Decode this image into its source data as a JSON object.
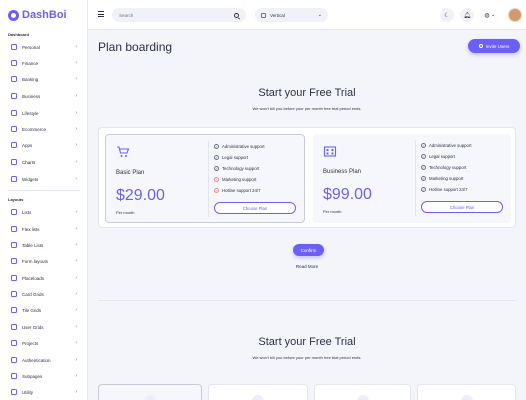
{
  "brand": {
    "name": "DashBoi"
  },
  "sidebar": {
    "sections": [
      {
        "title": "Dashboard",
        "items": [
          {
            "label": "Personal",
            "icon": "home-icon"
          },
          {
            "label": "Finance",
            "icon": "finance-icon"
          },
          {
            "label": "Banking",
            "icon": "bank-icon"
          },
          {
            "label": "Business",
            "icon": "briefcase-icon"
          },
          {
            "label": "Lifestyle",
            "icon": "heart-icon"
          },
          {
            "label": "Ecommerce",
            "icon": "cart-icon"
          },
          {
            "label": "Apps",
            "icon": "apps-icon"
          },
          {
            "label": "Charts",
            "icon": "chart-icon"
          },
          {
            "label": "Widgets",
            "icon": "widgets-icon"
          }
        ]
      },
      {
        "title": "Layouts",
        "items": [
          {
            "label": "Lists",
            "icon": "list-icon"
          },
          {
            "label": "Flex lists",
            "icon": "flex-list-icon"
          },
          {
            "label": "Table Lists",
            "icon": "table-icon"
          },
          {
            "label": "Form layouts",
            "icon": "form-icon"
          },
          {
            "label": "Placeloads",
            "icon": "placeload-icon"
          },
          {
            "label": "Card Grids",
            "icon": "card-grid-icon"
          },
          {
            "label": "Tile Grids",
            "icon": "tile-grid-icon"
          },
          {
            "label": "User Grids",
            "icon": "user-grid-icon"
          },
          {
            "label": "Projects",
            "icon": "folder-icon"
          },
          {
            "label": "Authentication",
            "icon": "lock-icon"
          },
          {
            "label": "Subpages",
            "icon": "page-icon"
          },
          {
            "label": "Utility",
            "icon": "tool-icon"
          }
        ]
      }
    ]
  },
  "topbar": {
    "search_placeholder": "Search",
    "layout_value": "Vertical"
  },
  "main": {
    "page_title": "Plan boarding",
    "invite_label": "Invite Users",
    "trial_title": "Start your Free Trial",
    "trial_sub": "We won't bill you before your per month free trial period ends.",
    "plans": [
      {
        "name": "Basic Plan",
        "price": "$29.00",
        "per": "Per month",
        "button": "Choose Plan",
        "icon": "cart-icon",
        "selected": true,
        "features": [
          {
            "label": "Administrative support",
            "included": true
          },
          {
            "label": "Legal support",
            "included": true
          },
          {
            "label": "Technology support",
            "included": true
          },
          {
            "label": "Marketing support",
            "included": false
          },
          {
            "label": "Hotline support 24/7",
            "included": false
          }
        ]
      },
      {
        "name": "Business Plan",
        "price": "$99.00",
        "per": "Per month",
        "button": "Choose Plan",
        "icon": "building-icon",
        "selected": false,
        "features": [
          {
            "label": "Administrative support",
            "included": true
          },
          {
            "label": "Legal support",
            "included": true
          },
          {
            "label": "Technology support",
            "included": true
          },
          {
            "label": "Marketing support",
            "included": true
          },
          {
            "label": "Hotline support 24/7",
            "included": true
          }
        ]
      }
    ],
    "confirm_label": "Confirm",
    "read_more": "Read More",
    "trial_title_2": "Start your Free Trial",
    "trial_sub_2": "We won't bill you before your per month free trial period ends."
  },
  "colors": {
    "accent": "#6c5ff7",
    "danger": "#f28b8b",
    "text": "#2b2f45"
  }
}
